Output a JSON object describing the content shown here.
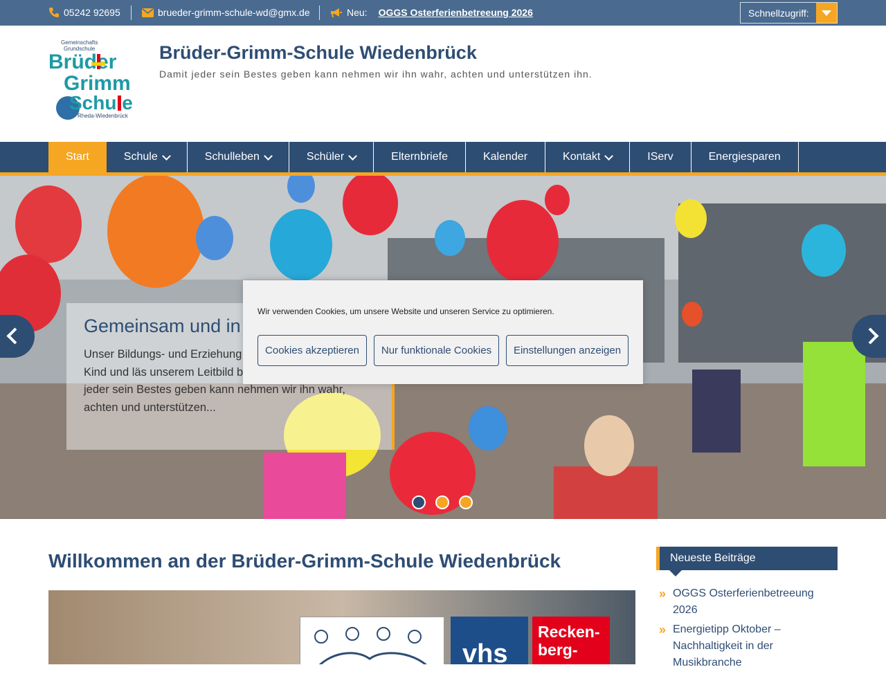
{
  "topbar": {
    "phone": "05242 92695",
    "email": "brueder-grimm-schule-wd@gmx.de",
    "news_label": "Neu:",
    "news_link": "OGGS Osterferienbetreeung 2026",
    "quick_access": "Schnellzugriff:"
  },
  "header": {
    "title": "Brüder-Grimm-Schule Wiedenbrück",
    "description": "Damit jeder sein Bestes geben kann nehmen wir ihn wahr, achten und unterstützen ihn.",
    "logo_text": [
      "Gemeinschafts",
      "Grundschule",
      "Brüder",
      "Grimm",
      "Schule",
      "Rheda-Wiedenbrück"
    ]
  },
  "nav": {
    "items": [
      {
        "label": "Start",
        "active": true
      },
      {
        "label": "Schule"
      },
      {
        "label": "Schulleben"
      },
      {
        "label": "Schüler"
      },
      {
        "label": "Elternbriefe"
      },
      {
        "label": "Kalender"
      },
      {
        "label": "Kontakt"
      },
      {
        "label": "IServ"
      },
      {
        "label": "Energiesparen"
      }
    ]
  },
  "hero": {
    "caption_title": "Gemeinsam und in",
    "caption_text": "Unser Bildungs- und Erziehung sich am einzelnen Kind und läs unserem Leitbild beschreiben: \"Damit jeder sein Bestes geben kann nehmen wir ihn wahr, achten und unterstützen...",
    "slides": 3,
    "active_slide": 1
  },
  "cookie": {
    "message": "Wir verwenden Cookies, um unsere Website und unseren Service zu optimieren.",
    "accept": "Cookies akzeptieren",
    "functional": "Nur funktionale Cookies",
    "settings": "Einstellungen anzeigen"
  },
  "main": {
    "title": "Willkommen an der Brüder-Grimm-Schule Wiedenbrück",
    "feature_logos": {
      "vhs": "vhs",
      "reckenberg_1": "Recken-",
      "reckenberg_2": "berg-"
    }
  },
  "sidebar": {
    "heading": "Neueste Beiträge",
    "posts": [
      "OGGS Osterferienbetreeung 2026",
      "Energietipp Oktober – Nachhaltigkeit in der Musikbranche"
    ]
  },
  "colors": {
    "navy": "#2e4d73",
    "orange": "#f5a623",
    "topbar": "#4a6b8f"
  }
}
